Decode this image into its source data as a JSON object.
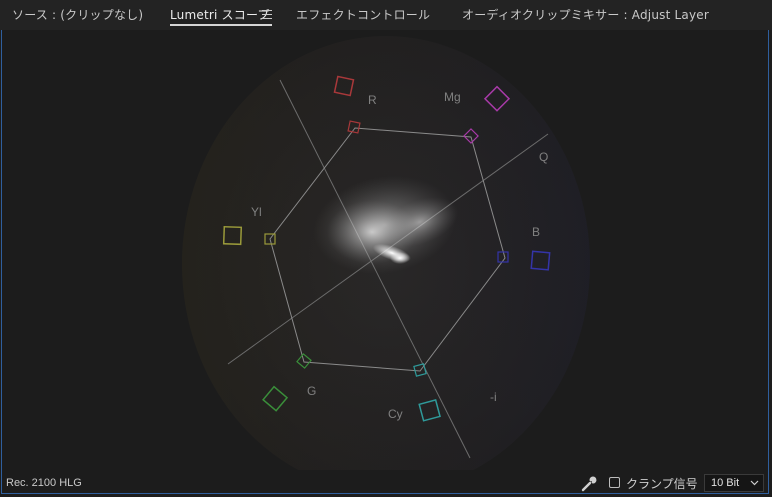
{
  "tabs": [
    {
      "label": "ソース : (クリップなし)",
      "active": false
    },
    {
      "label": "Lumetri スコープ",
      "active": true
    },
    {
      "label": "エフェクトコントロール",
      "active": false
    },
    {
      "label": "オーディオクリップミキサー : Adjust Layer",
      "active": false
    }
  ],
  "scope": {
    "type": "vectorscope",
    "targets": {
      "R": "#a8383a",
      "Mg": "#a83aa8",
      "B": "#3434a8",
      "Cy": "#2f9a9a",
      "G": "#3a8e3a",
      "Yl": "#9a9a3a"
    },
    "labels": {
      "R": "R",
      "Mg": "Mg",
      "Q": "Q",
      "B": "B",
      "Cy": "Cy",
      "neg_i": "-i",
      "G": "G",
      "Yl": "Yl"
    }
  },
  "footer": {
    "standard": "Rec. 2100 HLG",
    "clamp_label": "クランプ信号",
    "clamp_checked": false,
    "bit_depth": "10 Bit"
  }
}
